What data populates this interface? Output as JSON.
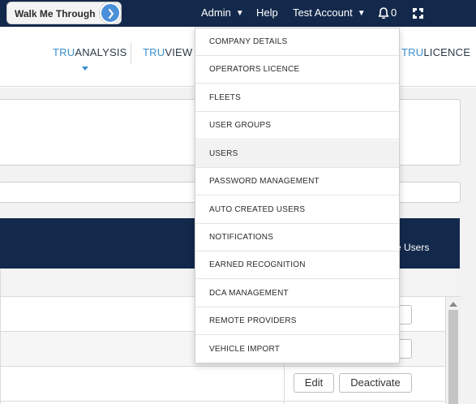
{
  "topbar": {
    "walk_me_through": "Walk Me Through",
    "admin": "Admin",
    "help": "Help",
    "account": "Test Account",
    "notification_count": "0"
  },
  "subnav": {
    "tabs": [
      {
        "prefix": "TRU",
        "rest": "ANALYSIS"
      },
      {
        "prefix": "TRU",
        "rest": "VIEW"
      },
      {
        "prefix": "TRU",
        "rest": "LICENCE"
      }
    ]
  },
  "page": {
    "header_partial_text": "ve Users"
  },
  "table": {
    "rows": [
      {
        "edit": "Edit",
        "deactivate": "Deactivate"
      }
    ]
  },
  "admin_menu": {
    "items": [
      "COMPANY DETAILS",
      "OPERATORS LICENCE",
      "FLEETS",
      "USER GROUPS",
      "USERS",
      "PASSWORD MANAGEMENT",
      "AUTO CREATED USERS",
      "NOTIFICATIONS",
      "EARNED RECOGNITION",
      "DCA MANAGEMENT",
      "REMOTE PROVIDERS",
      "VEHICLE IMPORT"
    ],
    "hovered_item": "USERS"
  },
  "colors": {
    "navy": "#13294b",
    "accent_blue": "#3a8fcf",
    "walk_circle": "#4a8fd8"
  }
}
